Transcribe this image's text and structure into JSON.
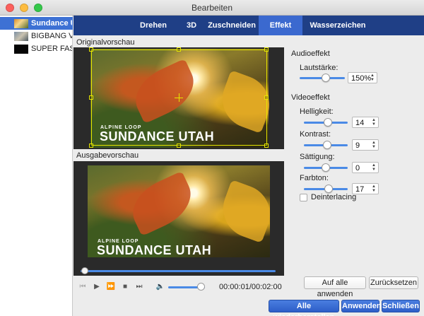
{
  "window": {
    "title": "Bearbeiten"
  },
  "files": [
    {
      "name": "Sundance Utah",
      "selected": true
    },
    {
      "name": "BIGBANG Video",
      "selected": false
    },
    {
      "name": "SUPER FAST",
      "selected": false
    }
  ],
  "tabs": [
    {
      "label": "Drehen",
      "active": false
    },
    {
      "label": "3D",
      "active": false
    },
    {
      "label": "Zuschneiden",
      "active": false
    },
    {
      "label": "Effekt",
      "active": true
    },
    {
      "label": "Wasserzeichen",
      "active": false
    }
  ],
  "preview": {
    "original_label": "Originalvorschau",
    "output_label": "Ausgabevorschau",
    "overlay_small": "ALPINE LOOP",
    "overlay_big": "SUNDANCE UTAH"
  },
  "playback": {
    "timecode": "00:00:01/00:02:00",
    "progress": 0.02,
    "volume": 0.9
  },
  "audio": {
    "group_title": "Audioeffekt",
    "volume_label": "Lautstärke:",
    "volume_value": "150%",
    "volume_level": 0.6
  },
  "video": {
    "group_title": "Videoeffekt",
    "params": [
      {
        "label": "Helligkeit:",
        "value": "14",
        "level": 0.57
      },
      {
        "label": "Kontrast:",
        "value": "9",
        "level": 0.54
      },
      {
        "label": "Sättigung:",
        "value": "0",
        "level": 0.5
      },
      {
        "label": "Farbton:",
        "value": "17",
        "level": 0.58
      }
    ],
    "deinterlace_label": "Deinterlacing",
    "deinterlace_checked": false
  },
  "buttons": {
    "apply_all": "Auf alle anwenden",
    "reset": "Zurücksetzen",
    "restore_all": "Alle wiederherstellen",
    "apply": "Anwenden",
    "close": "Schließen"
  },
  "colors": {
    "tabbar": "#1f3f86",
    "tab_active": "#3b69cf",
    "accent": "#4a8ae6",
    "selection": "#3d71d4",
    "crop": "#e6e600"
  }
}
